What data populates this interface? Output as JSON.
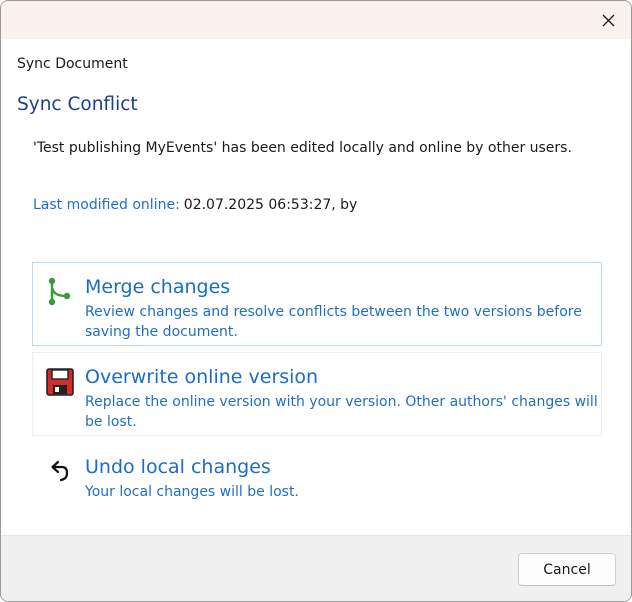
{
  "window": {
    "title": "Sync Document"
  },
  "dialog": {
    "heading": "Sync Conflict",
    "message": "'Test publishing MyEvents' has been edited locally and online by other users.",
    "last_modified_label": "Last modified online:",
    "last_modified_value": "02.07.2025 06:53:27, by"
  },
  "options": [
    {
      "icon": "merge-branch-icon",
      "title": "Merge changes",
      "description": "Review changes and resolve conflicts between the two versions before saving the document."
    },
    {
      "icon": "floppy-disk-icon",
      "title": "Overwrite online version",
      "description": "Replace the online version with your version. Other authors' changes will be lost."
    },
    {
      "icon": "undo-arrow-icon",
      "title": "Undo local changes",
      "description": "Your local changes will be lost."
    }
  ],
  "footer": {
    "cancel_label": "Cancel"
  },
  "colors": {
    "link_blue": "#1c6cc4",
    "heading_blue": "#1d3f8c",
    "merge_green": "#3a9b3a",
    "floppy_red": "#d42a2a"
  }
}
